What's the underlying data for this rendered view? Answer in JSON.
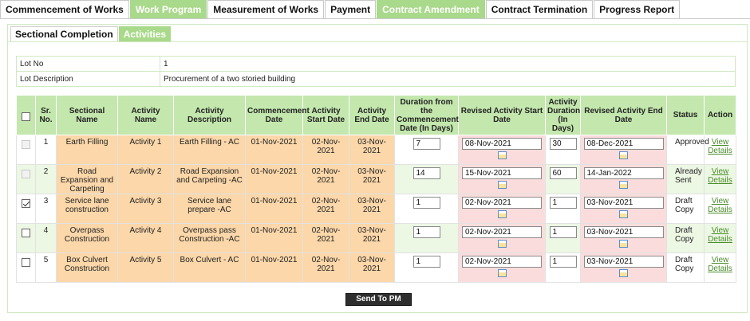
{
  "top_tabs": [
    "Commencement of Works",
    "Work Program",
    "Measurement of Works",
    "Payment",
    "Contract Amendment",
    "Contract Termination",
    "Progress Report"
  ],
  "sub_tabs": [
    "Sectional Completion",
    "Activities"
  ],
  "lot": {
    "no_label": "Lot No",
    "no_value": "1",
    "desc_label": "Lot Description",
    "desc_value": "Procurement of a two storied building"
  },
  "headers": {
    "sr": "Sr. No.",
    "sectional": "Sectional Name",
    "activity": "Activity Name",
    "desc": "Activity Description",
    "commencement": "Commencement Date",
    "start": "Activity Start Date",
    "end": "Activity End Date",
    "duration": "Duration from the Commencement Date (In Days)",
    "rev_start": "Revised Activity Start Date",
    "act_duration": "Activity Duration (In Days)",
    "rev_end": "Revised Activity End Date",
    "status": "Status",
    "action": "Action"
  },
  "rows": [
    {
      "sr": "1",
      "sectional": "Earth Filling",
      "activity": "Activity 1",
      "desc": "Earth Filling - AC",
      "commencement": "01-Nov-2021",
      "start": "02-Nov-2021",
      "end": "03-Nov-2021",
      "duration": "7",
      "rev_start": "08-Nov-2021",
      "act_duration": "30",
      "rev_end": "08-Dec-2021",
      "status": "Approved",
      "action": "View Details"
    },
    {
      "sr": "2",
      "sectional": "Road Expansion and Carpeting",
      "activity": "Activity 2",
      "desc": "Road Expansion and Carpeting -AC",
      "commencement": "01-Nov-2021",
      "start": "02-Nov-2021",
      "end": "03-Nov-2021",
      "duration": "14",
      "rev_start": "15-Nov-2021",
      "act_duration": "60",
      "rev_end": "14-Jan-2022",
      "status": "Already Sent",
      "action": "View Details"
    },
    {
      "sr": "3",
      "sectional": "Service lane construction",
      "activity": "Activity 3",
      "desc": "Service lane prepare -AC",
      "commencement": "01-Nov-2021",
      "start": "02-Nov-2021",
      "end": "03-Nov-2021",
      "duration": "1",
      "rev_start": "02-Nov-2021",
      "act_duration": "1",
      "rev_end": "03-Nov-2021",
      "status": "Draft Copy",
      "action": "View Details"
    },
    {
      "sr": "4",
      "sectional": "Overpass Construction",
      "activity": "Activity 4",
      "desc": "Overpass pass Construction -AC",
      "commencement": "01-Nov-2021",
      "start": "02-Nov-2021",
      "end": "03-Nov-2021",
      "duration": "1",
      "rev_start": "02-Nov-2021",
      "act_duration": "1",
      "rev_end": "03-Nov-2021",
      "status": "Draft Copy",
      "action": "View Details"
    },
    {
      "sr": "5",
      "sectional": "Box Culvert Construction",
      "activity": "Activity 5",
      "desc": "Box Culvert - AC",
      "commencement": "01-Nov-2021",
      "start": "02-Nov-2021",
      "end": "03-Nov-2021",
      "duration": "1",
      "rev_start": "02-Nov-2021",
      "act_duration": "1",
      "rev_end": "03-Nov-2021",
      "status": "Draft Copy",
      "action": "View Details"
    }
  ],
  "send_button": "Send To PM",
  "colors": {
    "accent": "#a9d98a",
    "header_bg": "#c3e7ad",
    "orange": "#fbd7a9",
    "pink": "#fbdcdc",
    "link": "#4a8c2a"
  },
  "icons": {
    "calendar": "calendar-icon",
    "checkbox": "checkbox"
  }
}
